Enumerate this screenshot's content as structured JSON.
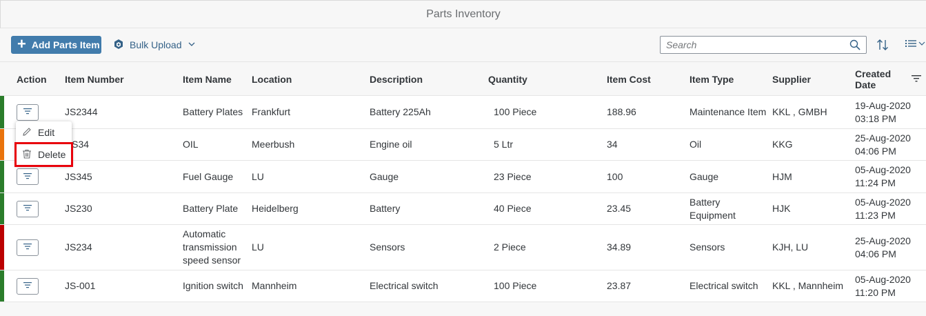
{
  "app": {
    "title": "Parts Inventory"
  },
  "toolbar": {
    "add_label": "Add Parts Item",
    "bulk_label": "Bulk Upload",
    "search_placeholder": "Search"
  },
  "columns": [
    "Action",
    "Item Number",
    "Item Name",
    "Location",
    "Description",
    "Quantity",
    "Item Cost",
    "Item Type",
    "Supplier",
    "Created Date"
  ],
  "rows": [
    {
      "status_color": "#2b7d2b",
      "item_number": "JS2344",
      "item_name": "Battery Plates",
      "location": "Frankfurt",
      "description": "Battery 225Ah",
      "quantity": "100  Piece",
      "cost": "188.96",
      "type": "Maintenance Item",
      "supplier": "KKL , GMBH",
      "date": "19-Aug-2020",
      "time": "03:18 PM"
    },
    {
      "status_color": "#e9730c",
      "item_number": "RS34",
      "item_name": "OIL",
      "location": "Meerbush",
      "description": "Engine oil",
      "quantity": "5  Ltr",
      "cost": "34",
      "type": "Oil",
      "supplier": "KKG",
      "date": "25-Aug-2020",
      "time": "04:06 PM"
    },
    {
      "status_color": "#2b7d2b",
      "item_number": "JS345",
      "item_name": "Fuel Gauge",
      "location": "LU",
      "description": "Gauge",
      "quantity": "23  Piece",
      "cost": "100",
      "type": "Gauge",
      "supplier": "HJM",
      "date": "05-Aug-2020",
      "time": "11:24 PM"
    },
    {
      "status_color": "#2b7d2b",
      "item_number": "JS230",
      "item_name": "Battery Plate",
      "location": "Heidelberg",
      "description": "Battery",
      "quantity": "40  Piece",
      "cost": "23.45",
      "type": "Battery Equipment",
      "supplier": "HJK",
      "date": "05-Aug-2020",
      "time": "11:23 PM"
    },
    {
      "status_color": "#bb0000",
      "item_number": "JS234",
      "item_name": "Automatic transmission speed sensor",
      "location": "LU",
      "description": "Sensors",
      "quantity": "2  Piece",
      "cost": "34.89",
      "type": "Sensors",
      "supplier": "KJH, LU",
      "date": "25-Aug-2020",
      "time": "04:06 PM"
    },
    {
      "status_color": "#2b7d2b",
      "item_number": "JS-001",
      "item_name": "Ignition switch",
      "location": "Mannheim",
      "description": "Electrical switch",
      "quantity": "100  Piece",
      "cost": "23.87",
      "type": "Electrical switch",
      "supplier": "KKL , Mannheim",
      "date": "05-Aug-2020",
      "time": "11:20 PM"
    }
  ],
  "popover": {
    "edit_label": "Edit",
    "delete_label": "Delete"
  },
  "colors": {
    "accent": "#427cac",
    "highlight": "#e8000b",
    "success": "#2b7d2b",
    "warning": "#e9730c",
    "error": "#bb0000"
  }
}
